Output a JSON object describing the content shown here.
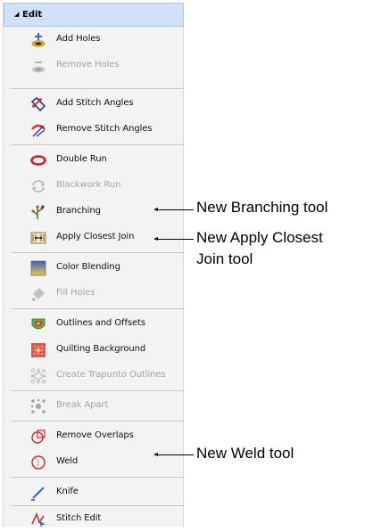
{
  "panel": {
    "title": "Edit",
    "items": [
      {
        "label": "Add Holes",
        "icon": "add-holes-icon"
      },
      {
        "label": "Remove Holes",
        "icon": "remove-holes-icon"
      },
      {
        "label": "Add Stitch Angles",
        "icon": "add-stitch-angles-icon"
      },
      {
        "label": "Remove Stitch Angles",
        "icon": "remove-stitch-angles-icon"
      },
      {
        "label": "Double Run",
        "icon": "double-run-icon"
      },
      {
        "label": "Blackwork Run",
        "icon": "blackwork-run-icon"
      },
      {
        "label": "Branching",
        "icon": "branching-icon"
      },
      {
        "label": "Apply Closest Join",
        "icon": "apply-closest-join-icon"
      },
      {
        "label": "Color Blending",
        "icon": "color-blending-icon"
      },
      {
        "label": "Fill Holes",
        "icon": "fill-holes-icon"
      },
      {
        "label": "Outlines and Offsets",
        "icon": "outlines-and-offsets-icon"
      },
      {
        "label": "Quilting Background",
        "icon": "quilting-background-icon"
      },
      {
        "label": "Create Trapunto Outlines",
        "icon": "create-trapunto-outlines-icon"
      },
      {
        "label": "Break Apart",
        "icon": "break-apart-icon"
      },
      {
        "label": "Remove Overlaps",
        "icon": "remove-overlaps-icon"
      },
      {
        "label": "Weld",
        "icon": "weld-icon"
      },
      {
        "label": "Knife",
        "icon": "knife-icon"
      },
      {
        "label": "Stitch Edit",
        "icon": "stitch-edit-icon"
      }
    ]
  },
  "callouts": {
    "branching": "New Branching tool",
    "apply_closest_join_line1": "New Apply Closest",
    "apply_closest_join_line2": "Join tool",
    "weld": "New Weld tool"
  },
  "colors": {
    "header_bg": "#cfe1f6",
    "panel_bg": "#f3f3f3",
    "disabled_text": "#a3a3a3"
  }
}
